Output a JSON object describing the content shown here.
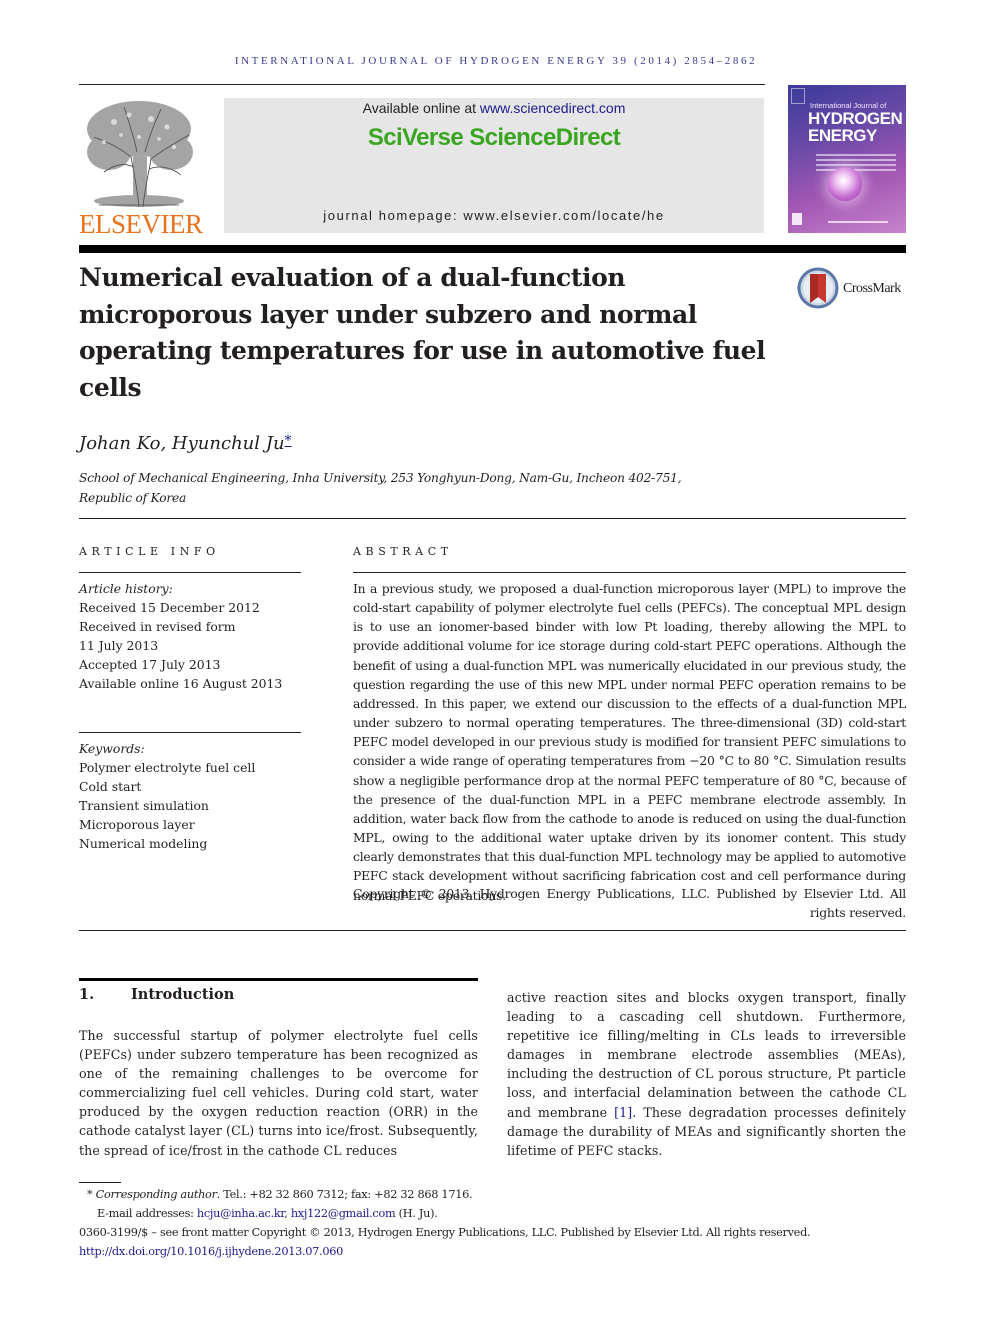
{
  "header": {
    "running_head": "International Journal of Hydrogen Energy 39 (2014) 2854–2862",
    "publisher_logo_text": "ELSEVIER",
    "banner": {
      "available_prefix": "Available online at ",
      "available_link": "www.sciencedirect.com",
      "brand": "SciVerse ScienceDirect",
      "homepage_prefix": "journal homepage: ",
      "homepage_link": "www.elsevier.com/locate/he"
    },
    "cover": {
      "line1": "International Journal of",
      "line2": "HYDROGEN",
      "line3": "ENERGY"
    },
    "colors": {
      "running_head": "#3a3a8c",
      "elsevier_orange": "#e9711c",
      "sciencedirect_green": "#3aa520",
      "link_blue": "#1b1b8a",
      "banner_bg": "#e6e6e6"
    }
  },
  "article": {
    "title": "Numerical evaluation of a dual-function microporous layer under subzero and normal operating temperatures for use in automotive fuel cells",
    "crossmark_label": "CrossMark",
    "authors": "Johan Ko, Hyunchul Ju",
    "corresponding_mark": "*",
    "affiliation_line1": "School of Mechanical Engineering, Inha University, 253 Yonghyun-Dong, Nam-Gu, Incheon 402-751,",
    "affiliation_line2": "Republic of Korea"
  },
  "article_info": {
    "label": "ARTICLE INFO",
    "history_heading": "Article history:",
    "history": [
      "Received 15 December 2012",
      "Received in revised form",
      "11 July 2013",
      "Accepted 17 July 2013",
      "Available online 16 August 2013"
    ],
    "keywords_heading": "Keywords:",
    "keywords": [
      "Polymer electrolyte fuel cell",
      "Cold start",
      "Transient simulation",
      "Microporous layer",
      "Numerical modeling"
    ]
  },
  "abstract": {
    "label": "ABSTRACT",
    "text": "In a previous study, we proposed a dual-function microporous layer (MPL) to improve the cold-start capability of polymer electrolyte fuel cells (PEFCs). The conceptual MPL design is to use an ionomer-based binder with low Pt loading, thereby allowing the MPL to provide additional volume for ice storage during cold-start PEFC operations. Although the benefit of using a dual-function MPL was numerically elucidated in our previous study, the question regarding the use of this new MPL under normal PEFC operation remains to be addressed. In this paper, we extend our discussion to the effects of a dual-function MPL under subzero to normal operating temperatures. The three-dimensional (3D) cold-start PEFC model developed in our previous study is modified for transient PEFC simulations to consider a wide range of operating temperatures from −20 °C to 80 °C. Simulation results show a negligible performance drop at the normal PEFC temperature of 80 °C, because of the presence of the dual-function MPL in a PEFC membrane electrode assembly. In addition, water back flow from the cathode to anode is reduced on using the dual-function MPL, owing to the additional water uptake driven by its ionomer content. This study clearly demonstrates that this dual-function MPL technology may be applied to automotive PEFC stack development without sacrificing fabrication cost and cell performance during normal PEFC operations.",
    "copyright": "Copyright © 2013, Hydrogen Energy Publications, LLC. Published by Elsevier Ltd. All rights reserved."
  },
  "introduction": {
    "number": "1.",
    "heading": "Introduction",
    "col1": "The successful startup of polymer electrolyte fuel cells (PEFCs) under subzero temperature has been recognized as one of the remaining challenges to be overcome for commercializing fuel cell vehicles. During cold start, water produced by the oxygen reduction reaction (ORR) in the cathode catalyst layer (CL) turns into ice/frost. Subsequently, the spread of ice/frost in the cathode CL reduces",
    "col2_before_ref": "active reaction sites and blocks oxygen transport, finally leading to a cascading cell shutdown. Furthermore, repetitive ice filling/melting in CLs leads to irreversible damages in membrane electrode assemblies (MEAs), including the destruction of CL porous structure, Pt particle loss, and interfacial delamination between the cathode CL and membrane ",
    "col2_ref": "[1]",
    "col2_after_ref": ". These degradation processes definitely damage the durability of MEAs and significantly shorten the lifetime of PEFC stacks."
  },
  "footnotes": {
    "star": "*",
    "corresponding_label": "Corresponding author",
    "contact": ". Tel.: +82 32 860 7312; fax: +82 32 868 1716.",
    "email_prefix": "E-mail addresses: ",
    "email1": "hcju@inha.ac.kr",
    "email_sep": ", ",
    "email2": "hxj122@gmail.com",
    "email_suffix": " (H. Ju).",
    "issn_line": "0360-3199/$ – see front matter Copyright © 2013, Hydrogen Energy Publications, LLC. Published by Elsevier Ltd. All rights reserved.",
    "doi": "http://dx.doi.org/10.1016/j.ijhydene.2013.07.060"
  }
}
